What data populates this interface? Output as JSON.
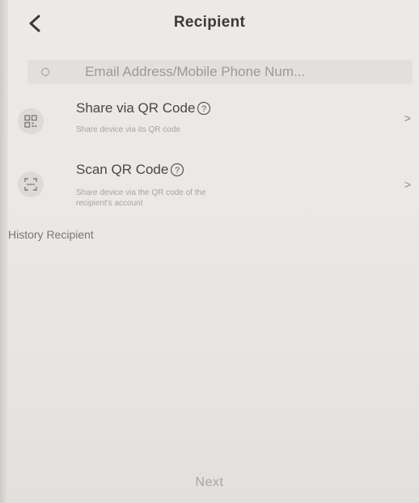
{
  "header": {
    "title": "Recipient",
    "back_icon": "chevron-left-icon"
  },
  "search": {
    "placeholder": "Email Address/Mobile Phone Num...",
    "value": ""
  },
  "options": [
    {
      "title": "Share via QR Code",
      "description": "Share device via its QR code",
      "icon": "qr-code-icon",
      "chevron": ">"
    },
    {
      "title": "Scan QR Code",
      "description_lines": [
        "Share device via the QR code of the",
        "recipient's account"
      ],
      "icon": "scan-qr-icon",
      "chevron": ">"
    }
  ],
  "history": {
    "label": "History Recipient"
  },
  "footer": {
    "next_label": "Next"
  },
  "colors": {
    "background": "#e9e6e3",
    "title_text": "#3c3937",
    "muted_text": "#a8a4a1"
  }
}
